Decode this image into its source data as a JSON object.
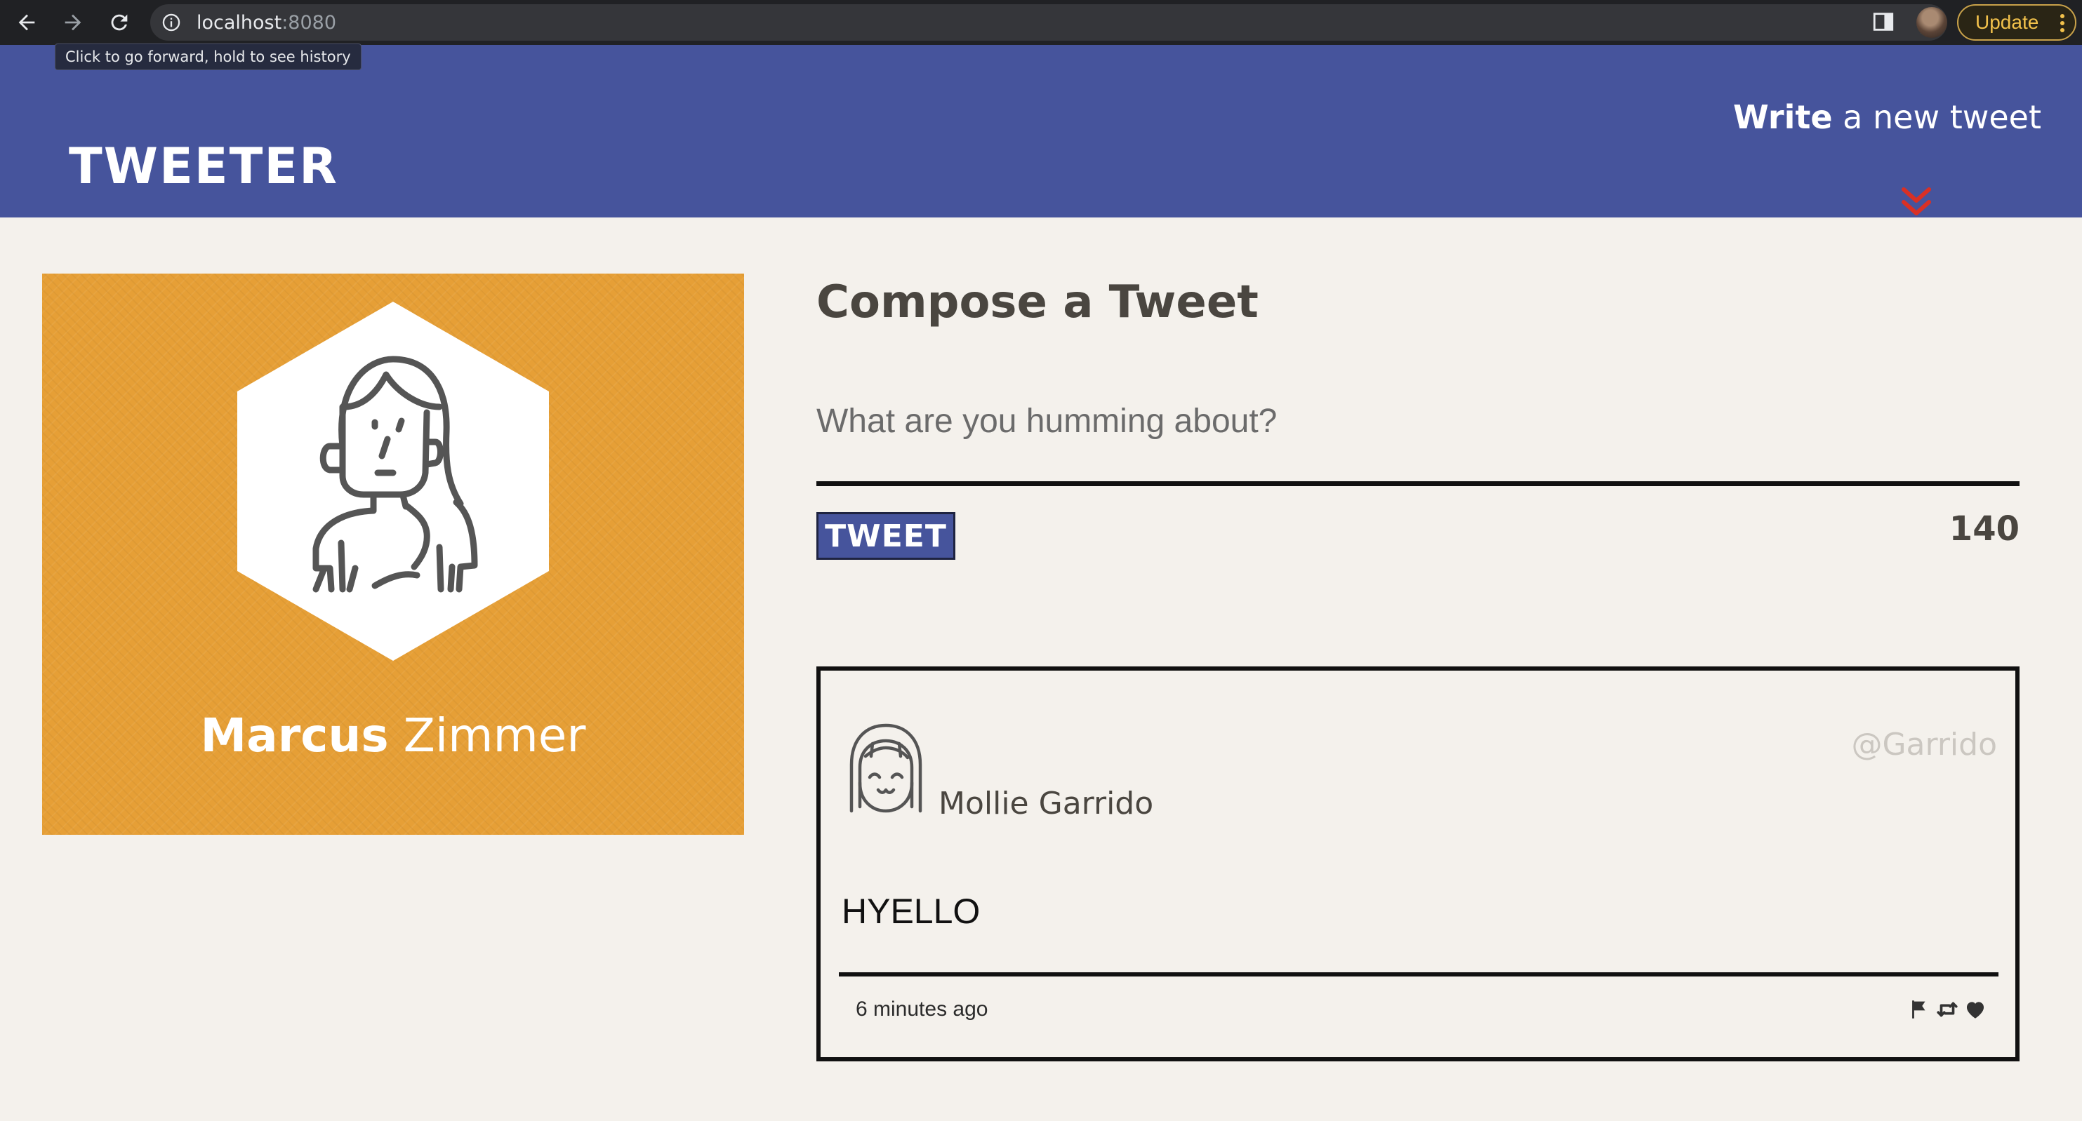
{
  "browser": {
    "url_host": "localhost",
    "url_port": ":8080",
    "update_label": "Update",
    "tooltip": "Click to go forward, hold to see history",
    "icons": [
      "back-arrow-icon",
      "forward-arrow-icon",
      "reload-icon",
      "info-icon",
      "share-icon",
      "star-icon",
      "side-panel-icon",
      "menu-dots-icon"
    ]
  },
  "header": {
    "logo": "TWEETER",
    "write_bold": "Write",
    "write_rest": " a new tweet",
    "chevron_icon": "double-chevron-down-icon",
    "background": "#46549c",
    "chevron_color": "#d93025"
  },
  "profile": {
    "first_name": "Marcus",
    "last_name": " Zimmer",
    "card_color": "#e69f36",
    "avatar_icon": "long-hair-person-icon"
  },
  "compose": {
    "title": "Compose a Tweet",
    "placeholder": "What are you humming about?",
    "button_label": "TWEET",
    "counter": "140"
  },
  "tweets": [
    {
      "name": "Mollie Garrido",
      "handle": "@Garrido",
      "content": "HYELLO",
      "time": "6 minutes ago",
      "avatar_icon": "smiling-girl-avatar-icon",
      "actions": [
        "flag-icon",
        "retweet-icon",
        "heart-icon"
      ]
    }
  ]
}
